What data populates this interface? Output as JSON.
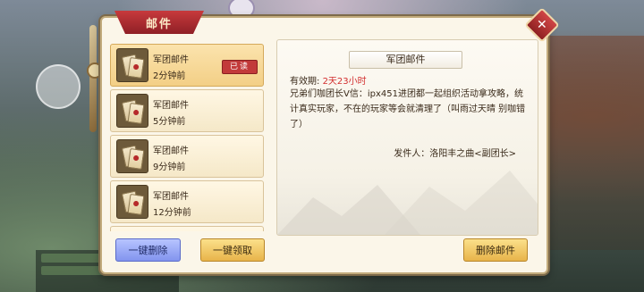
{
  "window": {
    "title": "邮件",
    "close_symbol": "✕"
  },
  "mail_list": [
    {
      "title": "军团邮件",
      "time": "2分钟前",
      "badge": "已读",
      "selected": true
    },
    {
      "title": "军团邮件",
      "time": "5分钟前"
    },
    {
      "title": "军团邮件",
      "time": "9分钟前"
    },
    {
      "title": "军团邮件",
      "time": "12分钟前"
    }
  ],
  "list_buttons": {
    "delete_all": "一键删除",
    "claim_all": "一键领取"
  },
  "detail": {
    "title": "军团邮件",
    "validity_label": "有效期:",
    "validity_value": "2天23小时",
    "body": "兄弟们咖团长V信：ipx451进团都一起组织活动拿攻略，统计真实玩家，不在的玩家等会就清理了（叫雨过天晴 别咖错了）",
    "sender": "发件人：洛阳丰之曲<副团长>",
    "delete_button": "删除邮件"
  },
  "colors": {
    "accent_red": "#c23a3a",
    "validity_red": "#d22e2e",
    "gold_button": "#e8b44a",
    "blue_button": "#8294ee"
  }
}
